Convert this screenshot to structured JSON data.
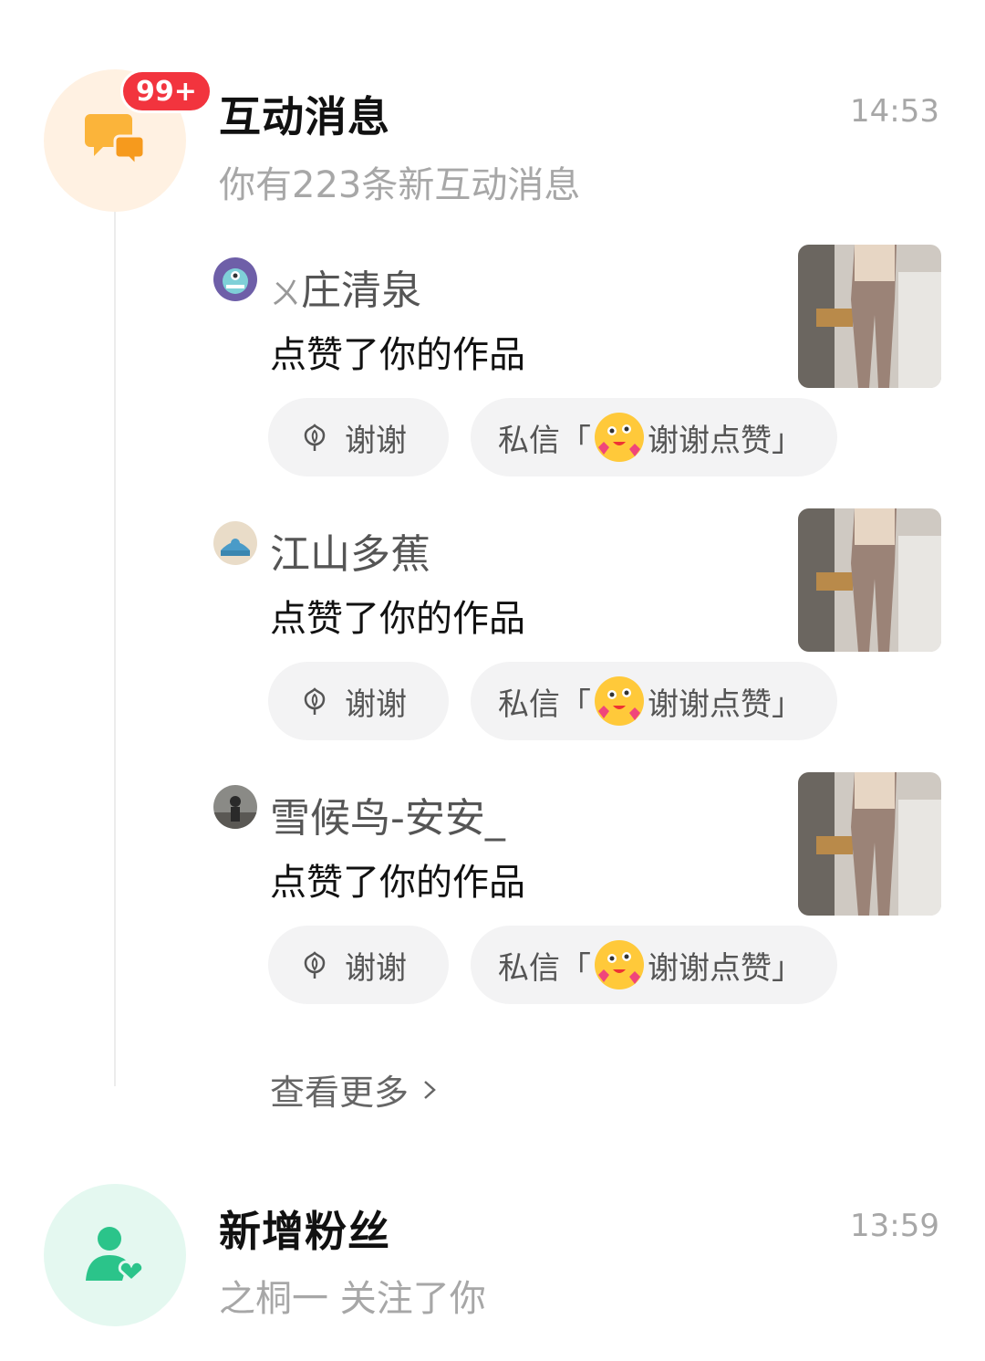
{
  "interactions": {
    "badge": "99+",
    "title": "互动消息",
    "time": "14:53",
    "subtitle": "你有223条新互动消息",
    "items": [
      {
        "username": "庄清泉",
        "username_prefix": "ㄨ",
        "action": "点赞了你的作品",
        "thanks_label": "谢谢",
        "dm_prefix": "私信「",
        "dm_text": "谢谢点赞」"
      },
      {
        "username": "江山多蕉",
        "username_prefix": "",
        "action": "点赞了你的作品",
        "thanks_label": "谢谢",
        "dm_prefix": "私信「",
        "dm_text": "谢谢点赞」"
      },
      {
        "username": "雪候鸟-安安_",
        "username_prefix": "",
        "action": "点赞了你的作品",
        "thanks_label": "谢谢",
        "dm_prefix": "私信「",
        "dm_text": "谢谢点赞」"
      }
    ],
    "more_label": "查看更多"
  },
  "followers": {
    "title": "新增粉丝",
    "time": "13:59",
    "subtitle": "之桐一 关注了你"
  },
  "colors": {
    "badge": "#f2343e",
    "orange_icon": "#fbb43a",
    "green_icon": "#2bc48a",
    "pill_bg": "#f3f3f4"
  }
}
